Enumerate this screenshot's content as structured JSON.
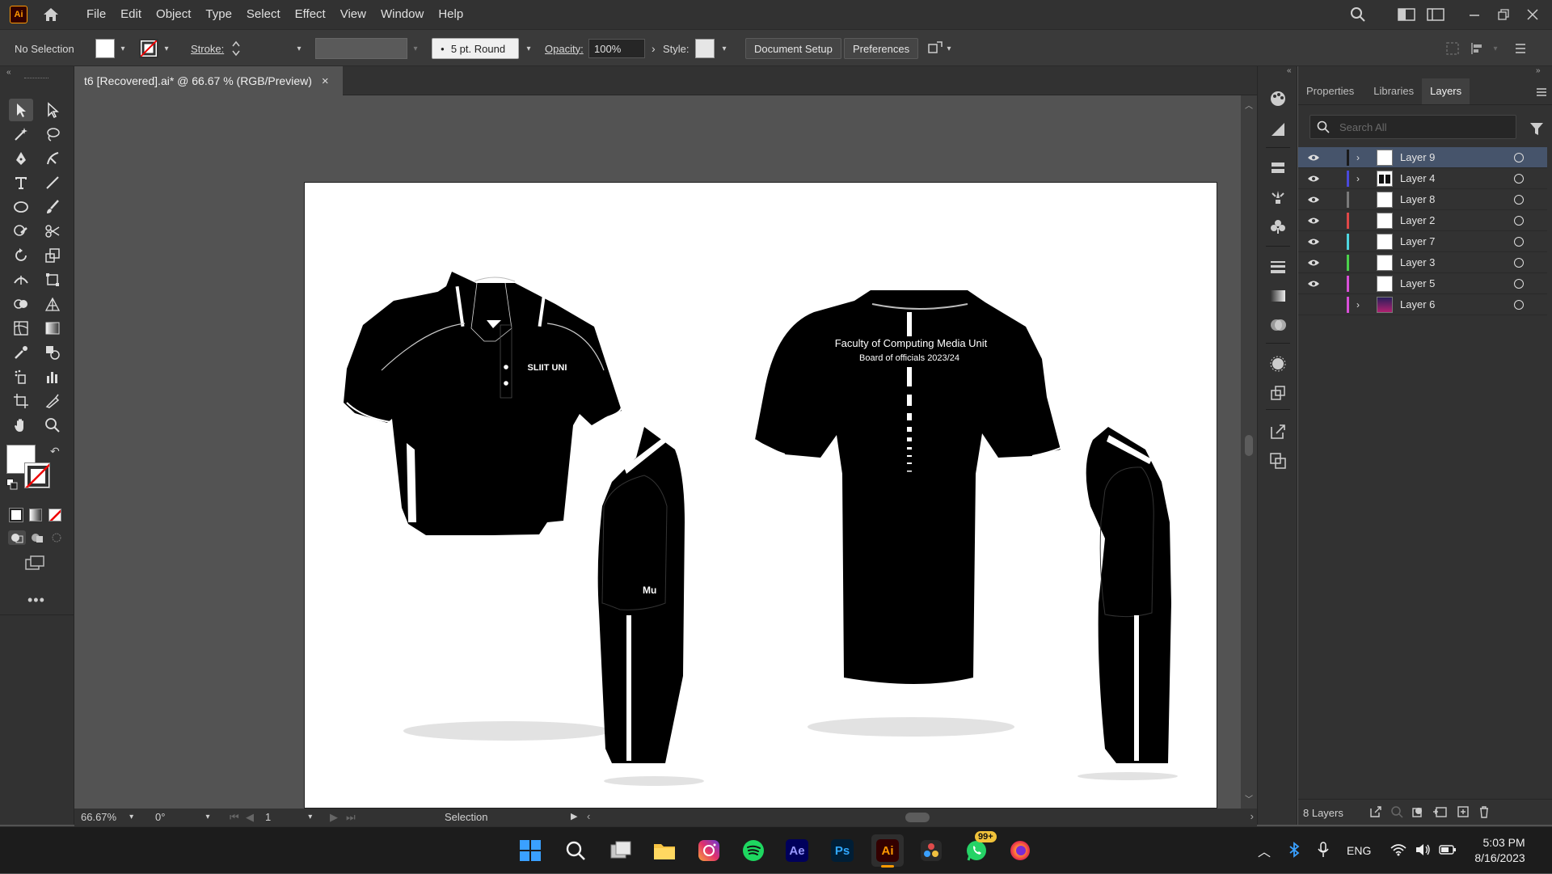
{
  "app": {
    "logo": "Ai"
  },
  "menu": {
    "items": [
      "File",
      "Edit",
      "Object",
      "Type",
      "Select",
      "Effect",
      "View",
      "Window",
      "Help"
    ]
  },
  "control_bar": {
    "selection_label": "No Selection",
    "stroke_label": "Stroke:",
    "brush_label": "5 pt. Round",
    "opacity_label": "Opacity:",
    "opacity_value": "100%",
    "style_label": "Style:",
    "document_setup": "Document Setup",
    "preferences": "Preferences"
  },
  "document": {
    "tab_title": "t6 [Recovered].ai* @ 66.67 % (RGB/Preview)",
    "close": "×"
  },
  "artwork": {
    "back_text_line1": "Faculty of Computing Media Unit",
    "back_text_line2": "Board of officials 2023/24",
    "chest_logo": "SLIIT UNI",
    "sleeve_logo": "Mu"
  },
  "status_bar": {
    "zoom": "66.67%",
    "rotation": "0°",
    "artboard_number": "1",
    "tool_name": "Selection"
  },
  "panel": {
    "tabs": [
      "Properties",
      "Libraries",
      "Layers"
    ],
    "active_tab": "Layers",
    "search_placeholder": "Search All",
    "layers": [
      {
        "name": "Layer 9",
        "color": "#2a2a2a",
        "expandable": true,
        "selected": true
      },
      {
        "name": "Layer 4",
        "color": "#4a4adb",
        "expandable": true,
        "selected": false
      },
      {
        "name": "Layer 8",
        "color": "#7a7a7a",
        "expandable": false,
        "selected": false
      },
      {
        "name": "Layer 2",
        "color": "#e04848",
        "expandable": false,
        "selected": false
      },
      {
        "name": "Layer 7",
        "color": "#4ed6e0",
        "expandable": false,
        "selected": false
      },
      {
        "name": "Layer 3",
        "color": "#4bd24b",
        "expandable": false,
        "selected": false
      },
      {
        "name": "Layer 5",
        "color": "#d94fd9",
        "expandable": false,
        "selected": false
      },
      {
        "name": "Layer 6",
        "color": "#d94fd9",
        "expandable": true,
        "selected": false
      }
    ],
    "footer_count": "8 Layers"
  },
  "taskbar": {
    "apps": [
      "windows-start",
      "search",
      "file-manager",
      "file-explorer",
      "instagram",
      "spotify",
      "after-effects",
      "photoshop",
      "illustrator",
      "davinci-resolve",
      "whatsapp",
      "firefox"
    ],
    "ae_label": "Ae",
    "ps_label": "Ps",
    "ai_label": "Ai",
    "whatsapp_badge": "99+",
    "language": "ENG",
    "time": "5:03 PM",
    "date": "8/16/2023"
  }
}
